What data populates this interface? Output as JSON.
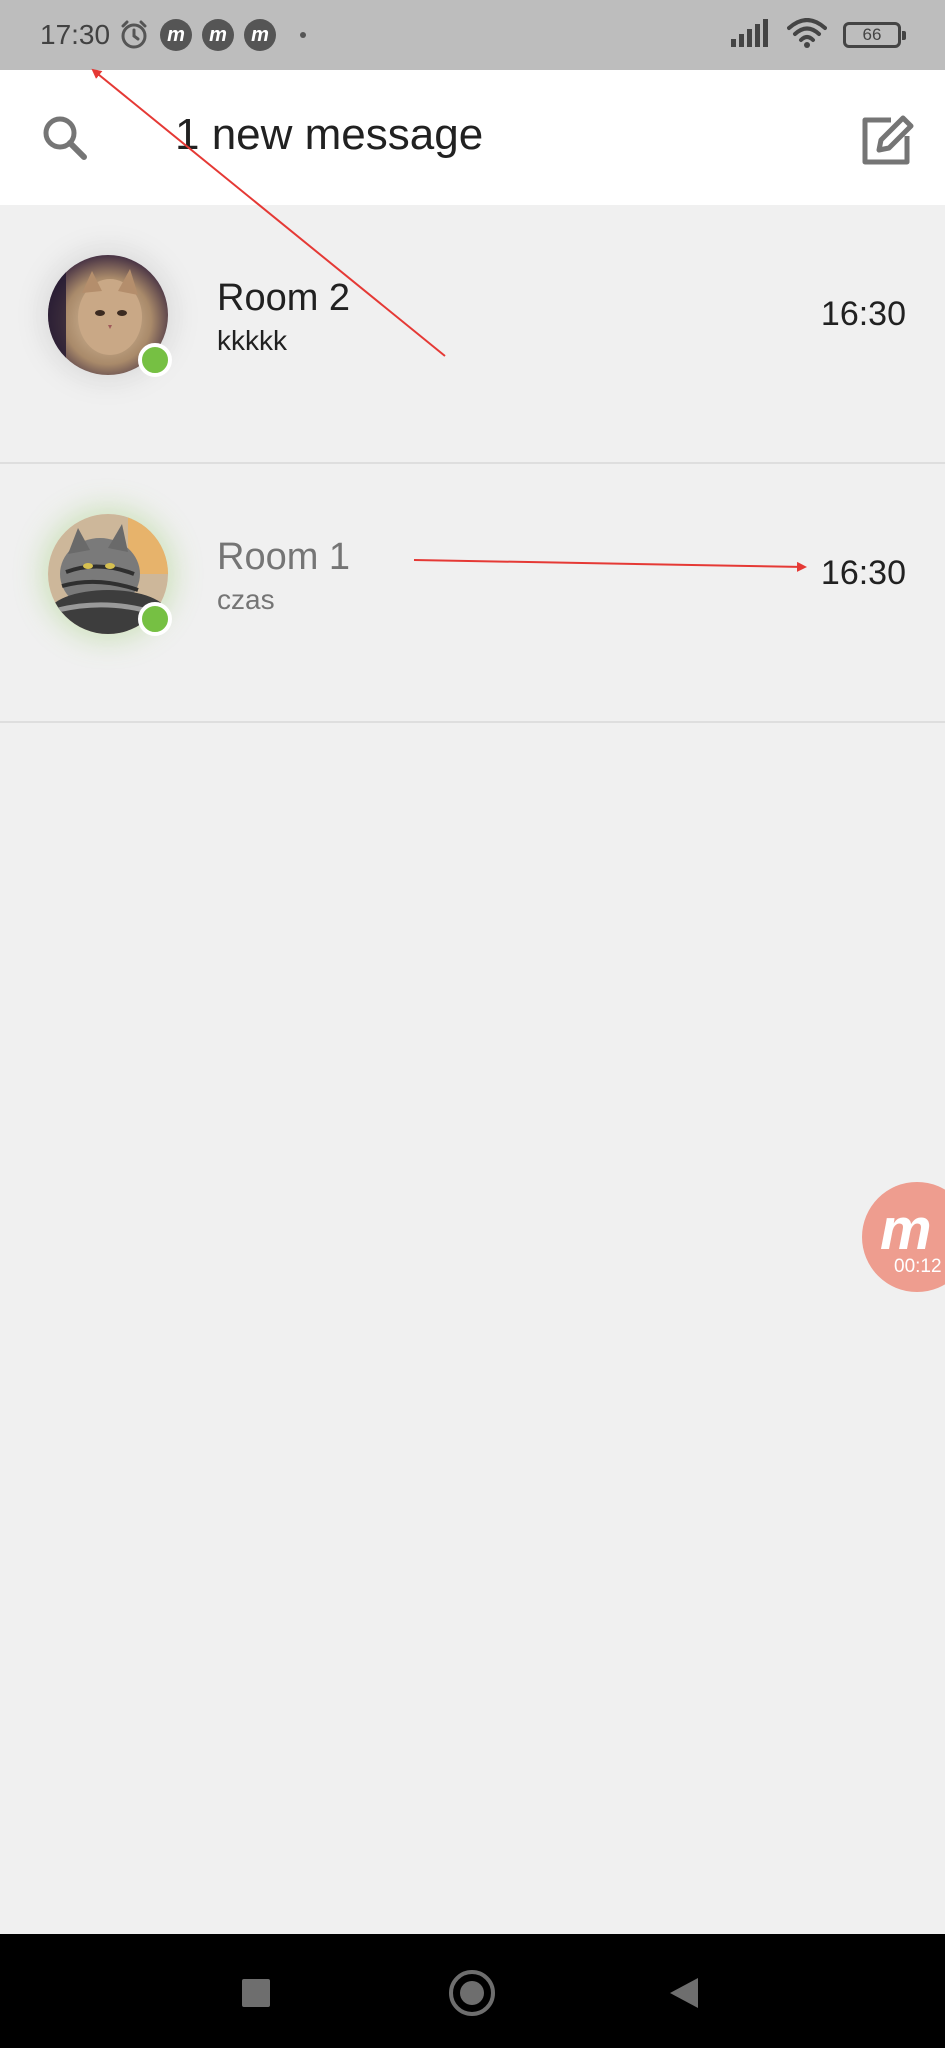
{
  "status_bar": {
    "time": "17:30",
    "battery": "66",
    "icons": [
      "alarm-icon",
      "m-app-icon",
      "m-app-icon",
      "m-app-icon",
      "notification-dot-icon",
      "signal-icon",
      "wifi-icon",
      "battery-icon"
    ]
  },
  "header": {
    "title": "1 new message",
    "search_icon": "search-icon",
    "compose_icon": "compose-icon"
  },
  "rooms": [
    {
      "name": "Room 2",
      "preview": "kkkkk",
      "time": "16:30",
      "unread": true,
      "online": true
    },
    {
      "name": "Room 1",
      "preview": "czas",
      "time": "16:30",
      "unread": false,
      "online": true
    }
  ],
  "recorder": {
    "label": "m",
    "elapsed": "00:12"
  },
  "nav_bar": {
    "icons": [
      "recents-icon",
      "home-icon",
      "back-icon"
    ]
  },
  "colors": {
    "status_bar_bg": "#bdbdbd",
    "header_bg": "#ffffff",
    "list_bg": "#f0f0f0",
    "online_green": "#76c043",
    "annotation_red": "#e53935",
    "recorder_bg": "#ee9d8f"
  }
}
